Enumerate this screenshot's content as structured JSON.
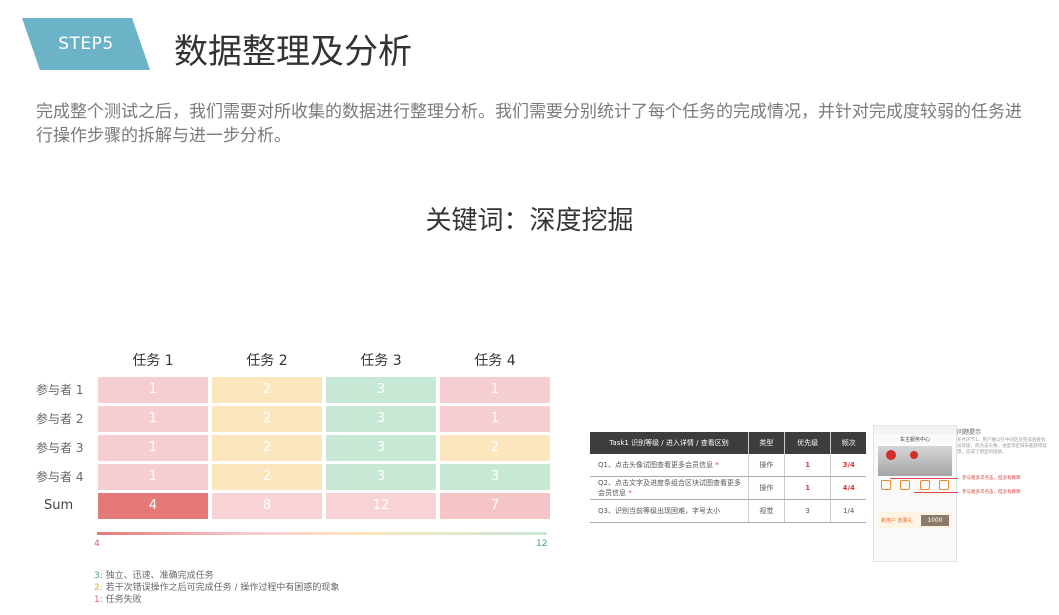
{
  "step": "STEP5",
  "title": "数据整理及分析",
  "description": "完成整个测试之后，我们需要对所收集的数据进行整理分析。我们需要分别统计了每个任务的完成情况，并针对完成度较弱的任务进行操作步骤的拆解与进一步分析。",
  "keyword": "关键词：深度挖掘",
  "matrix": {
    "tasks": [
      "任务 1",
      "任务 2",
      "任务 3",
      "任务 4"
    ],
    "rows": [
      {
        "label": "参与者 1",
        "values": [
          "1",
          "2",
          "3",
          "1"
        ],
        "levels": [
          "red",
          "yel",
          "grn",
          "red"
        ]
      },
      {
        "label": "参与者 2",
        "values": [
          "1",
          "2",
          "3",
          "1"
        ],
        "levels": [
          "red",
          "yel",
          "grn",
          "red"
        ]
      },
      {
        "label": "参与者 3",
        "values": [
          "1",
          "2",
          "3",
          "2"
        ],
        "levels": [
          "red",
          "yel",
          "grn",
          "yel"
        ]
      },
      {
        "label": "参与者 4",
        "values": [
          "1",
          "2",
          "3",
          "3"
        ],
        "levels": [
          "red",
          "yel",
          "grn",
          "grn"
        ]
      }
    ],
    "sum": {
      "label": "Sum",
      "values": [
        "4",
        "8",
        "12",
        "7"
      ],
      "levels": [
        "sum1",
        "sum3",
        "sum3",
        "sum2"
      ]
    },
    "scale_min": "4",
    "scale_max": "12"
  },
  "legend": [
    {
      "key": "3:",
      "text": "独立、迅速、准确完成任务",
      "color": "#4ba47a"
    },
    {
      "key": "2:",
      "text": "若干次错误操作之后可完成任务 / 操作过程中有困惑的现象",
      "color": "#e0a93a"
    },
    {
      "key": "1:",
      "text": "任务失败",
      "color": "#e06060"
    }
  ],
  "task_table": {
    "headers": [
      "Task1 识别等级 / 进入详情 / 查看区别",
      "类型",
      "优先级",
      "频次"
    ],
    "rows": [
      {
        "q": "Q1、点击头像试图查看更多会员信息",
        "mark": "*",
        "type": "操作",
        "priority": "1",
        "freq": "3/4",
        "hot": true
      },
      {
        "q": "Q2、点击文字及进度条组合区块试图查看更多会员信息",
        "mark": "*",
        "type": "操作",
        "priority": "1",
        "freq": "4/4",
        "hot": true
      },
      {
        "q": "Q3、识别当前等级出现困难，字号太小",
        "mark": "",
        "type": "视觉",
        "priority": "3",
        "freq": "1/4",
        "hot": false
      }
    ]
  },
  "phone": {
    "header": "车主服务中心",
    "ad_text": "新用户 放量礼",
    "ad_badge": "1000"
  },
  "annotation": {
    "title": "问题提示",
    "body": "任务环节1、用户难以在中间区块完成查看会员等级，而点击头像、进度等区域未能获得反馈，造成了明显的困惑。",
    "notes": [
      "参与者多次点击，但没有跳转",
      "参与者多次点击，但没有跳转"
    ]
  },
  "colors": {
    "step_tag": "#6cb3c8",
    "level_1": "#f6cdd1",
    "level_2": "#fbe6be",
    "level_3": "#c8e8d6",
    "sum_low": "#e57878",
    "table_header": "#3d3d3d",
    "alert": "#d23b3b"
  }
}
